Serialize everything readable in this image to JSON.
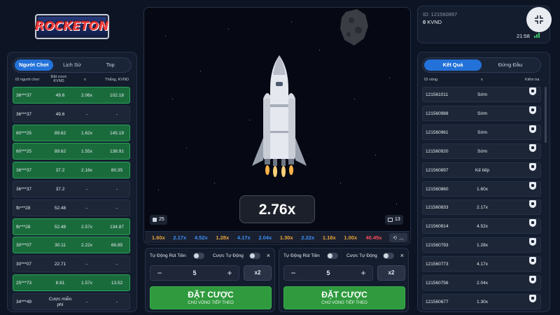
{
  "logo_text": "ROCKETON",
  "left": {
    "tabs": [
      {
        "label": "Người Chơi"
      },
      {
        "label": "Lịch Sử"
      },
      {
        "label": "Top"
      }
    ],
    "columns": {
      "id": "ID người chơi",
      "bet": "Đặt cược KVND",
      "x": "x",
      "win": "Thắng, KVND"
    },
    "rows": [
      {
        "id": "36***37",
        "bet": "49.6",
        "x": "2.06x",
        "win": "102.18",
        "won": true
      },
      {
        "id": "36***37",
        "bet": "49.6",
        "x": "-",
        "win": "-",
        "won": false
      },
      {
        "id": "60***25",
        "bet": "89.62",
        "x": "1.62x",
        "win": "145.19",
        "won": true
      },
      {
        "id": "60***25",
        "bet": "89.62",
        "x": "1.55x",
        "win": "138.91",
        "won": true
      },
      {
        "id": "36***37",
        "bet": "37.2",
        "x": "2.16x",
        "win": "80.35",
        "won": true
      },
      {
        "id": "36***37",
        "bet": "37.2",
        "x": "-",
        "win": "-",
        "won": false
      },
      {
        "id": "fb***28",
        "bet": "52.48",
        "x": "-",
        "win": "-",
        "won": false
      },
      {
        "id": "fb***28",
        "bet": "52.48",
        "x": "2.57x",
        "win": "134.87",
        "won": true
      },
      {
        "id": "30***07",
        "bet": "30.11",
        "x": "2.22x",
        "win": "66.85",
        "won": true
      },
      {
        "id": "30***07",
        "bet": "22.71",
        "x": "-",
        "win": "-",
        "won": false
      },
      {
        "id": "25***73",
        "bet": "8.61",
        "x": "1.57x",
        "win": "13.52",
        "won": true
      },
      {
        "id": "34***49",
        "bet": "Cược miễn phí",
        "x": "-",
        "win": "-",
        "won": false
      }
    ]
  },
  "game": {
    "multiplier": "2.76x",
    "players_count": "25",
    "bets_count": "13",
    "history": [
      {
        "v": "1.60x",
        "color": "#e9a33a"
      },
      {
        "v": "2.17x",
        "color": "#3b8ff5"
      },
      {
        "v": "4.52x",
        "color": "#3b8ff5"
      },
      {
        "v": "1.28x",
        "color": "#e9a33a"
      },
      {
        "v": "4.17x",
        "color": "#3b8ff5"
      },
      {
        "v": "2.04x",
        "color": "#3b8ff5"
      },
      {
        "v": "1.30x",
        "color": "#e9a33a"
      },
      {
        "v": "2.22x",
        "color": "#3b8ff5"
      },
      {
        "v": "1.18x",
        "color": "#e9a33a"
      },
      {
        "v": "1.00x",
        "color": "#e9a33a"
      },
      {
        "v": "40.45x",
        "color": "#ff4d5b"
      }
    ]
  },
  "bet_panels": [
    {
      "auto_cashout": "Tự Động Rút Tiền",
      "auto_bet": "Cược Tự Động",
      "amount": "5",
      "x2": "x2",
      "btn": "ĐẶT CƯỢC",
      "btn_sub": "CHO VÒNG TIẾP THEO"
    },
    {
      "auto_cashout": "Tự Động Rút Tiền",
      "auto_bet": "Cược Tự Động",
      "amount": "5",
      "x2": "x2",
      "btn": "ĐẶT CƯỢC",
      "btn_sub": "CHO VÒNG TIẾP THEO"
    }
  ],
  "account": {
    "id": "ID: 121560897",
    "balance": "0",
    "currency": "KVND",
    "time": "21:58"
  },
  "right": {
    "tabs": [
      {
        "label": "Kết Quả"
      },
      {
        "label": "Đứng Đầu"
      }
    ],
    "columns": {
      "id": "ID vòng",
      "x": "x",
      "check": "Kiểm tra"
    },
    "rows": [
      {
        "id": "121561011",
        "x": "Sớm"
      },
      {
        "id": "121560988",
        "x": "Sớm"
      },
      {
        "id": "121560961",
        "x": "Sớm"
      },
      {
        "id": "121560920",
        "x": "Sớm"
      },
      {
        "id": "121560897",
        "x": "Kế tiếp"
      },
      {
        "id": "121560860",
        "x": "1.60x"
      },
      {
        "id": "121560833",
        "x": "2.17x"
      },
      {
        "id": "121560814",
        "x": "4.52x"
      },
      {
        "id": "121560793",
        "x": "1.28x"
      },
      {
        "id": "121560773",
        "x": "4.17x"
      },
      {
        "id": "121560756",
        "x": "2.04x"
      },
      {
        "id": "121560677",
        "x": "1.30x"
      }
    ]
  }
}
